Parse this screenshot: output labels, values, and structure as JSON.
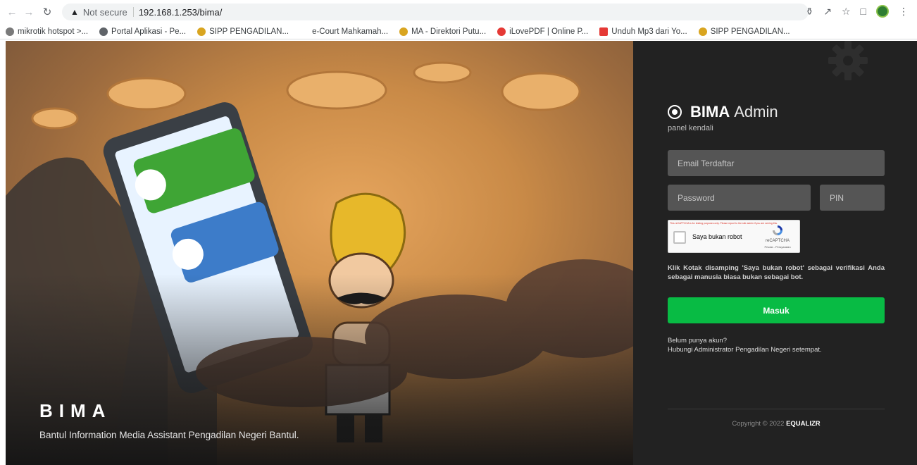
{
  "browser": {
    "status": "Not secure",
    "url": "192.168.1.253/bima/",
    "bookmarks": [
      {
        "label": "mikrotik hotspot >...",
        "color": "#7a7a7a"
      },
      {
        "label": "Portal Aplikasi - Pe...",
        "color": "#5f6368"
      },
      {
        "label": "SIPP PENGADILAN...",
        "color": "#d9a520"
      },
      {
        "label": "e-Court Mahkamah...",
        "color": "#ffffff"
      },
      {
        "label": "MA - Direktori Putu...",
        "color": "#d9a520"
      },
      {
        "label": "iLovePDF | Online P...",
        "color": "#e53935"
      },
      {
        "label": "Unduh Mp3 dari Yo...",
        "color": "#e53935"
      },
      {
        "label": "SIPP PENGADILAN...",
        "color": "#d9a520"
      }
    ]
  },
  "hero": {
    "title": "BIMA",
    "subtitle": "Bantul Information Media Assistant Pengadilan Negeri Bantul."
  },
  "login": {
    "brand_strong": "BIMA",
    "brand_light": "Admin",
    "tagline": "panel kendali",
    "email_placeholder": "Email Terdaftar",
    "password_placeholder": "Password",
    "pin_placeholder": "PIN",
    "captcha_error": "This reCAPTCHA is for testing purposes only. Please report to the site admin if you are seeing this.",
    "captcha_label": "Saya bukan robot",
    "captcha_brand": "reCAPTCHA",
    "captcha_links": "Privasi - Persyaratan",
    "hint": "Klik Kotak disamping 'Saya bukan robot' sebagai verifikasi Anda sebagai manusia biasa bukan sebagai bot.",
    "submit_label": "Masuk",
    "register_question": "Belum punya akun?",
    "register_answer": "Hubungi Administrator Pengadilan Negeri setempat.",
    "copyright_prefix": "Copyright © 2022",
    "copyright_brand": "EQUALIZR",
    "accent_color": "#08bb44"
  }
}
